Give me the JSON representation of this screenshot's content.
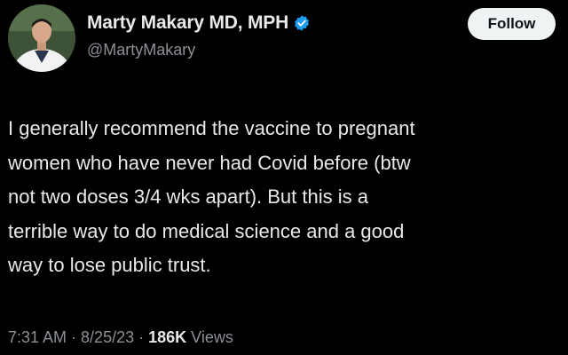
{
  "tweet": {
    "author": {
      "display_name": "Marty Makary MD, MPH",
      "handle": "@MartyMakary",
      "verified_icon": "verified-badge-icon",
      "avatar_icon": "avatar"
    },
    "follow_label": "Follow",
    "body_lines": [
      "I generally recommend the vaccine to pregnant",
      "women who have never had Covid before (btw",
      "not two doses 3/4 wks apart). But this is a",
      "terrible way to do medical science and a good",
      "way to lose public trust."
    ],
    "meta": {
      "time": "7:31 AM",
      "separator": "·",
      "date": "8/25/23",
      "views_count": "186K",
      "views_label": "Views"
    }
  },
  "colors": {
    "background": "#000000",
    "text_primary": "#e7e9ea",
    "text_secondary": "#8b9096",
    "verified_blue": "#1d9bf0",
    "follow_button_bg": "#eff3f4"
  }
}
